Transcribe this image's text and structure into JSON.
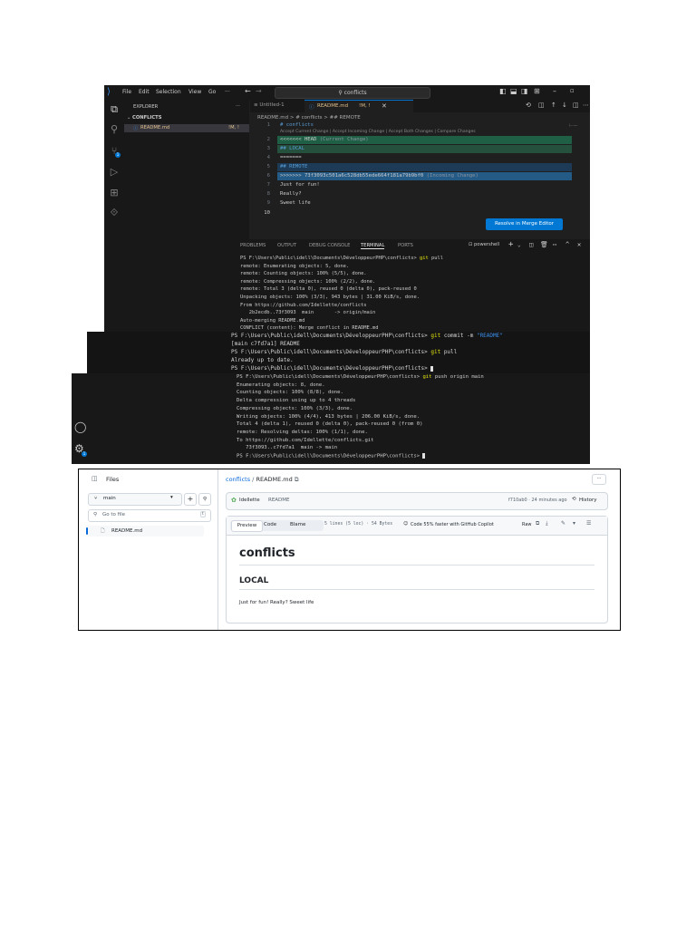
{
  "vscode": {
    "menu": [
      "File",
      "Edit",
      "Selection",
      "View",
      "Go",
      "···"
    ],
    "search_text": "conflicts",
    "explorer_title": "EXPLORER",
    "folder_name": "CONFLICTS",
    "file_name": "README.md",
    "file_badge": "!M, !",
    "tab_untitled": "Untitled-1",
    "tab_readme": "README.md",
    "tab_readme_badge": "!M, !",
    "breadcrumb": "README.md > # conflicts > ## REMOTE",
    "codelens": "Accept Current Change | Accept Incoming Change | Accept Both Changes | Compare Changes",
    "lines": [
      {
        "n": "1",
        "t": "# conflicts",
        "kind": "heading"
      },
      {
        "n": "2",
        "t": "<<<<<<< HEAD (Current Change)",
        "kind": "current-marker"
      },
      {
        "n": "3",
        "t": "## LOCAL",
        "kind": "current"
      },
      {
        "n": "4",
        "t": "=======",
        "kind": "plain"
      },
      {
        "n": "5",
        "t": "## REMOTE",
        "kind": "incoming"
      },
      {
        "n": "6",
        "t": ">>>>>>> 73f3093c501a6c528db55ede664f181a79b9bf0 (Incoming Change)",
        "kind": "incoming-marker"
      },
      {
        "n": "7",
        "t": "Just for fun!",
        "kind": "plain"
      },
      {
        "n": "8",
        "t": "Really?",
        "kind": "plain"
      },
      {
        "n": "9",
        "t": "Sweet life",
        "kind": "plain"
      },
      {
        "n": "10",
        "t": "",
        "kind": "plain"
      }
    ],
    "merge_button": "Resolve in Merge Editor"
  },
  "panel": {
    "tabs": [
      "PROBLEMS",
      "OUTPUT",
      "DEBUG CONSOLE",
      "TERMINAL",
      "PORTS"
    ],
    "shell": "powershell"
  },
  "terminal1": [
    {
      "p": "PS F:\\Users\\Public\\idell\\Documents\\DéveloppeurPHP\\conflicts> ",
      "c": "git",
      "r": " pull"
    },
    {
      "t": "remote: Enumerating objects: 5, done."
    },
    {
      "t": "remote: Counting objects: 100% (5/5), done."
    },
    {
      "t": "remote: Compressing objects: 100% (2/2), done."
    },
    {
      "t": "remote: Total 3 (delta 0), reused 0 (delta 0), pack-reused 0"
    },
    {
      "t": "Unpacking objects: 100% (3/3), 943 bytes | 31.00 KiB/s, done."
    },
    {
      "t": "From https://github.com/Idellette/conflicts"
    },
    {
      "t": "   2b2ecdb..73f3093  main       -> origin/main"
    },
    {
      "t": "Auto-merging README.md"
    },
    {
      "t": "CONFLICT (content): Merge conflict in README.md"
    }
  ],
  "terminal2": [
    {
      "p": "PS F:\\Users\\Public\\idell\\Documents\\DéveloppeurPHP\\conflicts> ",
      "c": "git",
      "r": " commit -m ",
      "s": "\"README\""
    },
    {
      "t": "[main c7fd7a1] README"
    },
    {
      "p": "PS F:\\Users\\Public\\idell\\Documents\\DéveloppeurPHP\\conflicts> ",
      "c": "git",
      "r": " pull"
    },
    {
      "t": "Already up to date."
    },
    {
      "p": "PS F:\\Users\\Public\\idell\\Documents\\DéveloppeurPHP\\conflicts> ",
      "cursor": true
    }
  ],
  "terminal3": [
    {
      "p": "PS F:\\Users\\Public\\idell\\Documents\\DéveloppeurPHP\\conflicts> ",
      "c": "git",
      "r": " push origin main"
    },
    {
      "t": "Enumerating objects: 8, done."
    },
    {
      "t": "Counting objects: 100% (8/8), done."
    },
    {
      "t": "Delta compression using up to 4 threads"
    },
    {
      "t": "Compressing objects: 100% (3/3), done."
    },
    {
      "t": "Writing objects: 100% (4/4), 413 bytes | 206.00 KiB/s, done."
    },
    {
      "t": "Total 4 (delta 1), reused 0 (delta 0), pack-reused 0 (from 0)"
    },
    {
      "t": "remote: Resolving deltas: 100% (1/1), done."
    },
    {
      "t": "To https://github.com/Idellette/conflicts.git"
    },
    {
      "t": "   73f3093..c7fd7a1  main -> main"
    },
    {
      "p": "PS F:\\Users\\Public\\idell\\Documents\\DéveloppeurPHP\\conflicts> ",
      "cursor": true
    }
  ],
  "github": {
    "files_label": "Files",
    "branch": "main",
    "go_to_file": "Go to file",
    "go_to_file_key": "t",
    "tree_file": "README.md",
    "crumb_repo": "conflicts",
    "crumb_sep": "/",
    "crumb_file": "README.md",
    "more": "···",
    "commit_user": "Idellette",
    "commit_msg": "README",
    "commit_meta": "f710ab0 · 24 minutes ago",
    "history": "History",
    "view_tabs": [
      "Preview",
      "Code",
      "Blame"
    ],
    "file_meta": "5 lines (5 loc) · 54 Bytes",
    "copilot": "Code 55% faster with GitHub Copilot",
    "raw": "Raw",
    "h1": "conflicts",
    "h2": "LOCAL",
    "body": "Just for fun! Really? Sweet life"
  }
}
